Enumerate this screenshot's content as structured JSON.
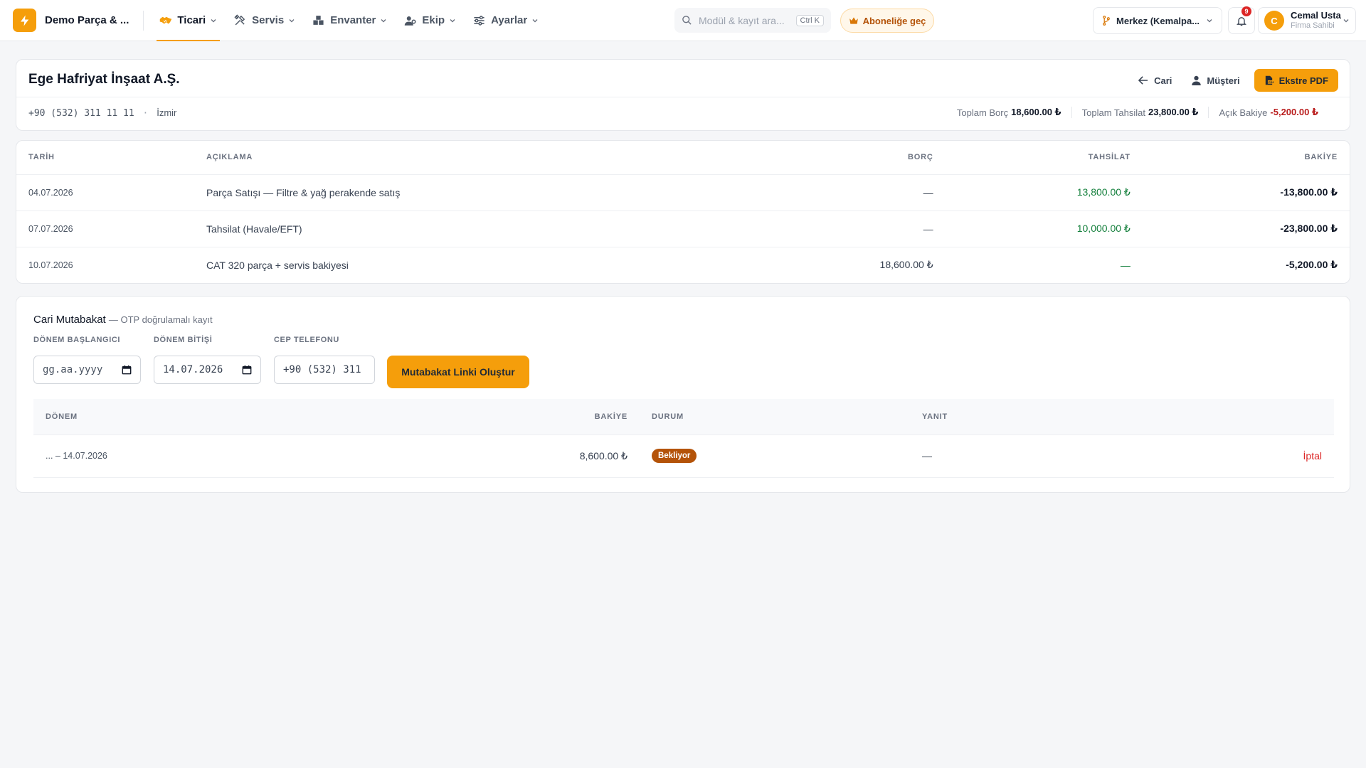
{
  "app": {
    "brand_name": "Demo Parça & ..."
  },
  "nav": [
    {
      "label": "Ticari",
      "icon": "handshake-icon",
      "active": true
    },
    {
      "label": "Servis",
      "icon": "tools-icon"
    },
    {
      "label": "Envanter",
      "icon": "warehouse-icon"
    },
    {
      "label": "Ekip",
      "icon": "team-icon"
    },
    {
      "label": "Ayarlar",
      "icon": "sliders-icon"
    }
  ],
  "search": {
    "placeholder": "Modül & kayıt ara...",
    "shortcut": "Ctrl K"
  },
  "upgrade": {
    "label": "Aboneliğe geç"
  },
  "branch": {
    "label": "Merkez (Kemalpa..."
  },
  "notifications": {
    "count": "9"
  },
  "user": {
    "initial": "C",
    "name": "Cemal Usta",
    "role": "Firma Sahibi"
  },
  "customer": {
    "name": "Ege Hafriyat İnşaat A.Ş.",
    "phone": "+90 (532) 311 11 11",
    "separator": "·",
    "city": "İzmir",
    "actions": {
      "back_label": "Cari",
      "customer_label": "Müşteri",
      "pdf_label": "Ekstre PDF"
    },
    "totals": {
      "debt_label": "Toplam Borç",
      "debt_value": "18,600.00 ₺",
      "collection_label": "Toplam Tahsilat",
      "collection_value": "23,800.00 ₺",
      "balance_label": "Açık Bakiye",
      "balance_value": "-5,200.00 ₺"
    }
  },
  "ledger": {
    "columns": {
      "date": "TARİH",
      "description": "AÇIKLAMA",
      "debt": "BORÇ",
      "collection": "TAHSİLAT",
      "balance": "BAKİYE"
    },
    "rows": [
      {
        "date": "04.07.2026",
        "description": "Parça Satışı — Filtre & yağ perakende satış",
        "debt": "—",
        "collection": "13,800.00 ₺",
        "balance": "-13,800.00 ₺"
      },
      {
        "date": "07.07.2026",
        "description": "Tahsilat (Havale/EFT)",
        "debt": "—",
        "collection": "10,000.00 ₺",
        "balance": "-23,800.00 ₺"
      },
      {
        "date": "10.07.2026",
        "description": "CAT 320 parça + servis bakiyesi",
        "debt": "18,600.00 ₺",
        "collection": "—",
        "balance": "-5,200.00 ₺"
      }
    ]
  },
  "reconciliation": {
    "title": "Cari Mutabakat",
    "subtitle": "— OTP doğrulamalı kayıt",
    "start_label": "DÖNEM BAŞLANGICI",
    "start_value": "gg.aa.yyyy",
    "end_label": "DÖNEM BİTİŞİ",
    "end_value": "14.07.2026",
    "phone_label": "CEP TELEFONU",
    "phone_value": "+90 (532) 311",
    "create_button": "Mutabakat Linki Oluştur",
    "columns": {
      "period": "DÖNEM",
      "balance": "BAKİYE",
      "status": "DURUM",
      "response": "YANIT"
    },
    "rows": [
      {
        "period": "... – 14.07.2026",
        "balance": "8,600.00 ₺",
        "status": "Bekliyor",
        "response": "—",
        "action": "İptal"
      }
    ]
  },
  "colors": {
    "accent": "#f59e0b",
    "credit": "#15803d",
    "negative": "#b91c1c",
    "status_pending": "#b45309",
    "danger": "#dc2626"
  }
}
